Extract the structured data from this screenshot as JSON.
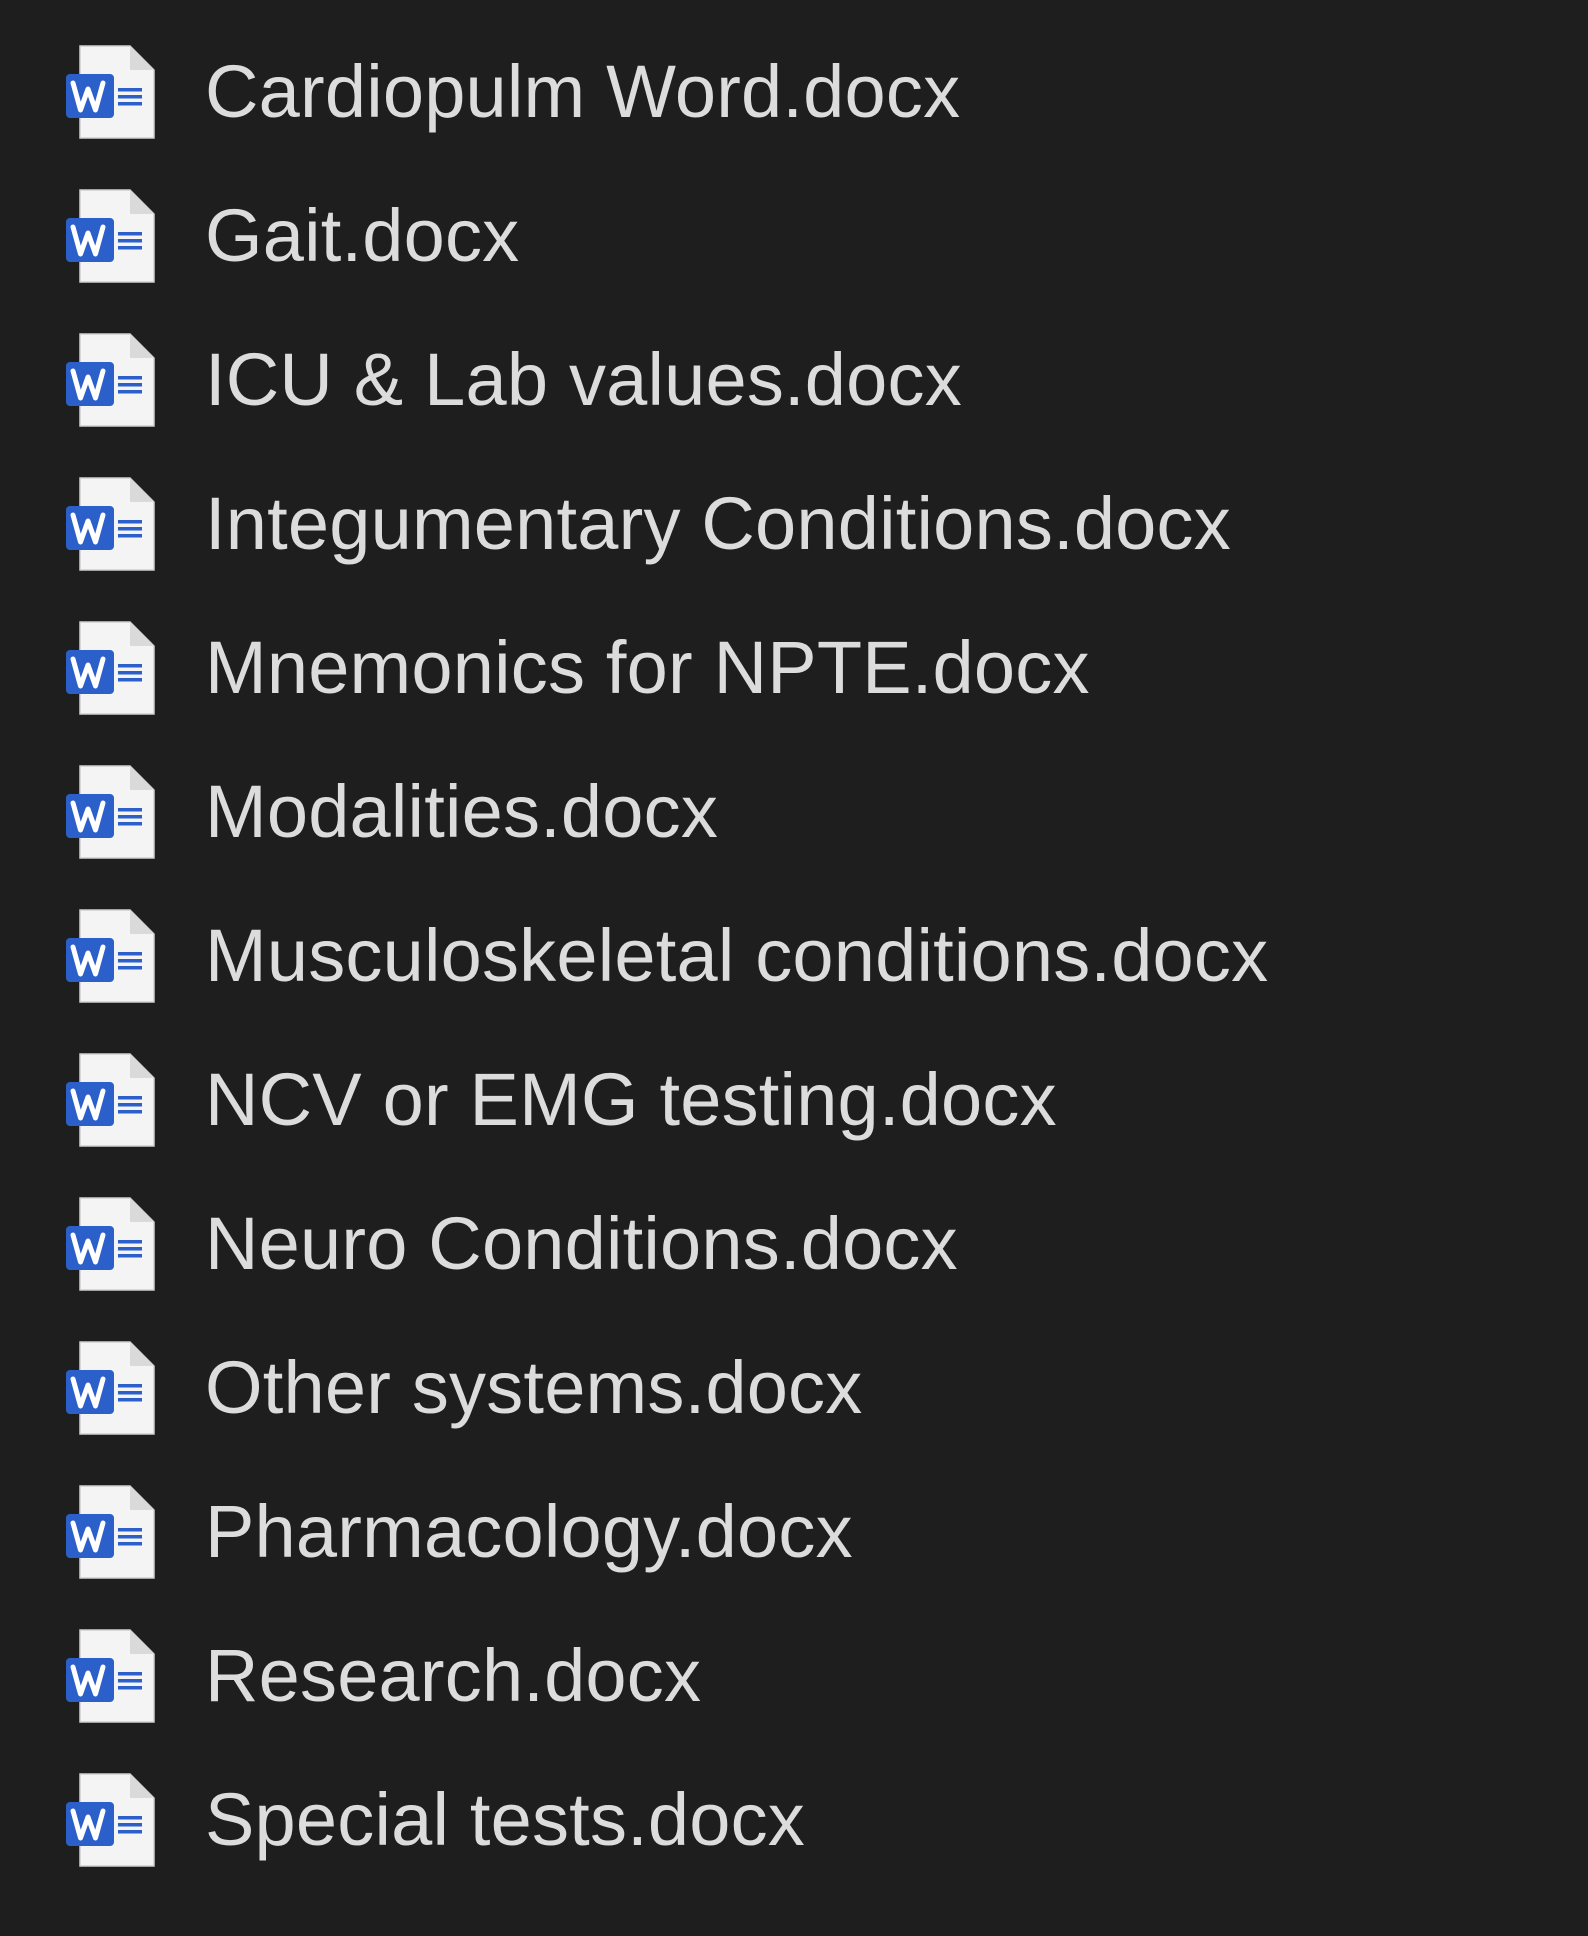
{
  "accent_color": "#2b5fc9",
  "text_color": "#dcdcdc",
  "background_color": "#1e1e1e",
  "files": [
    {
      "name": "Cardiopulm Word.docx",
      "icon": "word-document-icon"
    },
    {
      "name": "Gait.docx",
      "icon": "word-document-icon"
    },
    {
      "name": "ICU & Lab values.docx",
      "icon": "word-document-icon"
    },
    {
      "name": "Integumentary Conditions.docx",
      "icon": "word-document-icon"
    },
    {
      "name": "Mnemonics for NPTE.docx",
      "icon": "word-document-icon"
    },
    {
      "name": "Modalities.docx",
      "icon": "word-document-icon"
    },
    {
      "name": "Musculoskeletal conditions.docx",
      "icon": "word-document-icon"
    },
    {
      "name": "NCV or EMG testing.docx",
      "icon": "word-document-icon"
    },
    {
      "name": "Neuro Conditions.docx",
      "icon": "word-document-icon"
    },
    {
      "name": "Other systems.docx",
      "icon": "word-document-icon"
    },
    {
      "name": "Pharmacology.docx",
      "icon": "word-document-icon"
    },
    {
      "name": "Research.docx",
      "icon": "word-document-icon"
    },
    {
      "name": "Special tests.docx",
      "icon": "word-document-icon"
    }
  ]
}
